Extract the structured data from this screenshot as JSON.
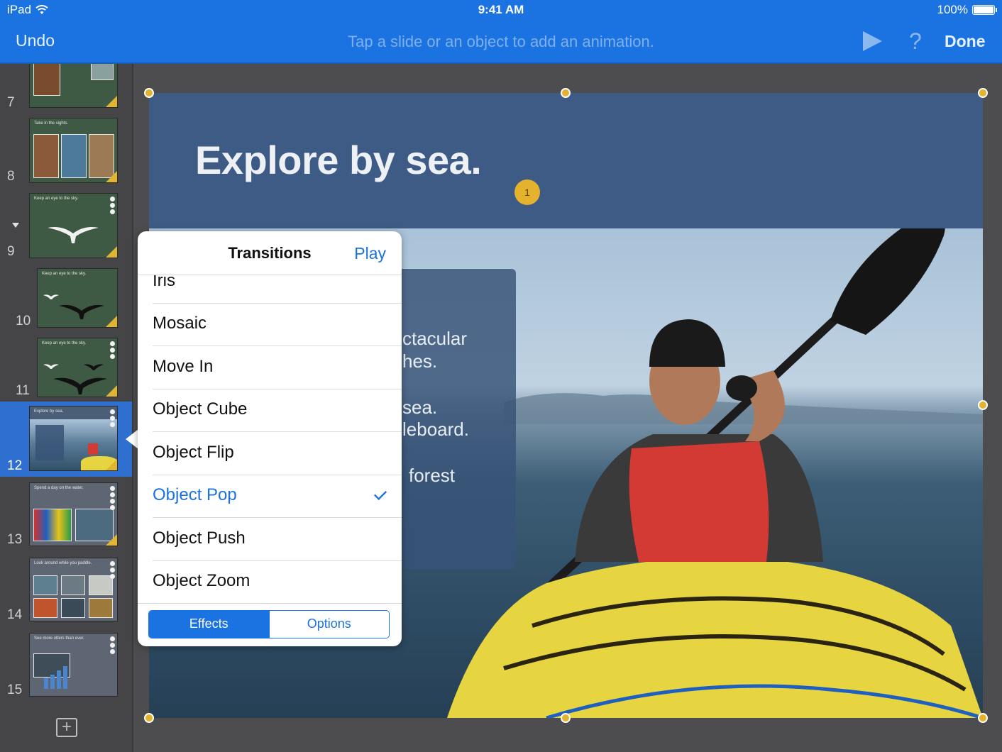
{
  "status_bar": {
    "device": "iPad",
    "time": "9:41 AM",
    "battery": "100%"
  },
  "toolbar": {
    "undo_label": "Undo",
    "hint": "Tap a slide or an object to add an animation.",
    "play_icon": "play-icon",
    "help_label": "?",
    "done_label": "Done"
  },
  "slides": [
    {
      "number": "7"
    },
    {
      "number": "8",
      "title": "Take in the sights."
    },
    {
      "number": "9",
      "title": "Keep an eye to the sky."
    },
    {
      "number": "10",
      "title": "Keep an eye to the sky."
    },
    {
      "number": "11",
      "title": "Keep an eye to the sky."
    },
    {
      "number": "12",
      "title": "Explore by sea.",
      "selected": true
    },
    {
      "number": "13",
      "title": "Spend a day on the water."
    },
    {
      "number": "14",
      "title": "Look around while you paddle."
    },
    {
      "number": "15",
      "title": "See more otters than ever."
    }
  ],
  "sidebar": {
    "add_slide_label": "+"
  },
  "slide": {
    "title": "Explore by sea.",
    "body_lines": [
      "ctacular",
      "hes.",
      "sea.",
      "leboard.",
      "forest"
    ],
    "animation_badge": "1"
  },
  "popover": {
    "title": "Transitions",
    "play_label": "Play",
    "items": [
      {
        "label": "Iris"
      },
      {
        "label": "Mosaic"
      },
      {
        "label": "Move In"
      },
      {
        "label": "Object Cube"
      },
      {
        "label": "Object Flip"
      },
      {
        "label": "Object Pop",
        "checked": true
      },
      {
        "label": "Object Push"
      },
      {
        "label": "Object Zoom"
      }
    ],
    "segments": [
      "Effects",
      "Options"
    ],
    "active_segment": "Effects"
  },
  "colors": {
    "accent": "#1a73e0",
    "badge": "#e5b22d",
    "sidebar_bg": "#454547",
    "selected_slide": "#2f6fd0"
  }
}
